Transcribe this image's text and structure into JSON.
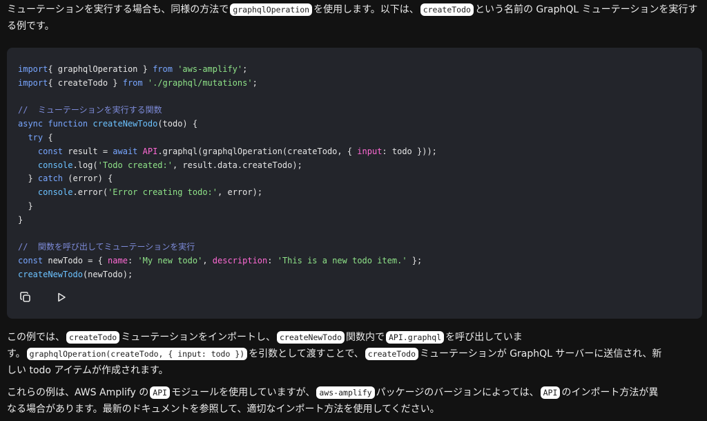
{
  "intro": {
    "t1": "ミューテーションを実行する場合も、同様の方法で",
    "c1": "graphqlOperation",
    "t2": "を使用します。以下は、",
    "c2": "createTodo",
    "t3": "という名前の GraphQL ミューテーションを実行する例です。"
  },
  "code_lines": [
    [
      [
        "kw",
        "import"
      ],
      [
        "",
        "{ graphqlOperation } "
      ],
      [
        "kw",
        "from"
      ],
      [
        "",
        ""
      ],
      [
        "str",
        " 'aws-amplify'"
      ],
      [
        "",
        ";"
      ]
    ],
    [
      [
        "kw",
        "import"
      ],
      [
        "",
        "{ createTodo } "
      ],
      [
        "kw",
        "from"
      ],
      [
        "str",
        " './graphql/mutations'"
      ],
      [
        "",
        ";"
      ]
    ],
    [],
    [
      [
        "cm",
        "//  ミューテーションを実行する関数"
      ]
    ],
    [
      [
        "kw",
        "async"
      ],
      [
        "",
        ""
      ],
      [
        "kw",
        " function"
      ],
      [
        "fn",
        " createNewTodo"
      ],
      [
        "",
        "(todo) {"
      ]
    ],
    [
      [
        "",
        ""
      ],
      [
        "kw",
        "  try"
      ],
      [
        "",
        " {"
      ]
    ],
    [
      [
        "",
        "    "
      ],
      [
        "kw",
        "const"
      ],
      [
        "",
        " result = "
      ],
      [
        "kw",
        "await"
      ],
      [
        "",
        ""
      ],
      [
        "pk",
        " API"
      ],
      [
        "",
        ".graphql(graphqlOperation(createTodo, { "
      ],
      [
        "pk",
        "input"
      ],
      [
        "",
        ": todo }));"
      ]
    ],
    [
      [
        "",
        "    "
      ],
      [
        "fn",
        "console"
      ],
      [
        "",
        ".log("
      ],
      [
        "str",
        "'Todo created:'"
      ],
      [
        "",
        ", result.data.createTodo);"
      ]
    ],
    [
      [
        "",
        "  } "
      ],
      [
        "kw",
        "catch"
      ],
      [
        "",
        " (error) {"
      ]
    ],
    [
      [
        "",
        "    "
      ],
      [
        "fn",
        "console"
      ],
      [
        "",
        ".error("
      ],
      [
        "str",
        "'Error creating todo:'"
      ],
      [
        "",
        ", error);"
      ]
    ],
    [
      [
        "",
        "  }"
      ]
    ],
    [
      [
        "",
        "}"
      ]
    ],
    [],
    [
      [
        "cm",
        "//  関数を呼び出してミューテーションを実行"
      ]
    ],
    [
      [
        "kw",
        "const"
      ],
      [
        "",
        " newTodo = { "
      ],
      [
        "pk",
        "name"
      ],
      [
        "",
        ": "
      ],
      [
        "str",
        "'My new todo'"
      ],
      [
        "",
        ", "
      ],
      [
        "pk",
        "description"
      ],
      [
        "",
        ": "
      ],
      [
        "str",
        "'This is a new todo item.'"
      ],
      [
        "",
        " };"
      ]
    ],
    [
      [
        "fn",
        "createNewTodo"
      ],
      [
        "",
        "(newTodo);"
      ]
    ]
  ],
  "toolbar": {
    "copy_icon": "copy-icon",
    "run_icon": "play-icon"
  },
  "explain": {
    "t1": "この例では、",
    "c1": "createTodo",
    "t2": "ミューテーションをインポートし、",
    "c2": "createNewTodo",
    "t3": "関数内で",
    "c3": "API.graphql",
    "t4": "を呼び出していま",
    "t5": "す。",
    "c4": "graphqlOperation(createTodo, { input: todo })",
    "t6": "を引数として渡すことで、",
    "c5": "createTodo",
    "t7": "ミューテーションが GraphQL サーバーに送信され、新",
    "t8": "しい todo アイテムが作成されます。"
  },
  "note": {
    "t1": "これらの例は、AWS Amplify の",
    "c1": "API",
    "t2": "モジュールを使用していますが、",
    "c2": "aws-amplify",
    "t3": "パッケージのバージョンによっては、",
    "c3": "API",
    "t4": "のインポート方法が異",
    "t5": "なる場合があります。最新のドキュメントを参照して、適切なインポート方法を使用してください。"
  },
  "colors": {
    "background": "#121212",
    "code_background": "#23252b",
    "keyword": "#78a6ff",
    "string": "#8fe388",
    "function": "#6cc2ff",
    "comment": "#7d8bd9",
    "property": "#ff6ad5"
  }
}
